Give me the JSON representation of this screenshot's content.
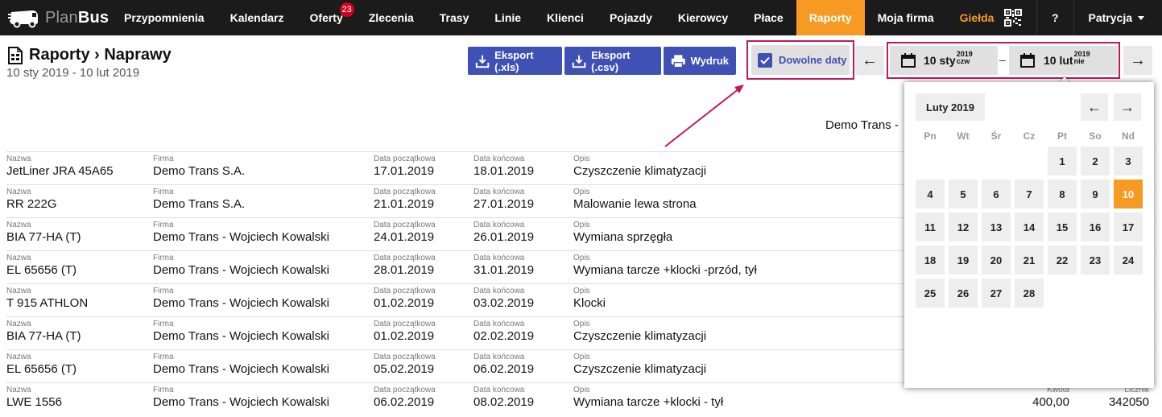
{
  "brand": {
    "part1": "Plan",
    "part2": "Bus"
  },
  "nav": {
    "items": [
      {
        "label": "Przypomnienia"
      },
      {
        "label": "Kalendarz"
      },
      {
        "label": "Oferty",
        "badge": "23"
      },
      {
        "label": "Zlecenia"
      },
      {
        "label": "Trasy"
      },
      {
        "label": "Linie"
      },
      {
        "label": "Klienci"
      },
      {
        "label": "Pojazdy"
      },
      {
        "label": "Kierowcy"
      },
      {
        "label": "Płace"
      },
      {
        "label": "Raporty",
        "active": true
      },
      {
        "label": "Moja firma"
      },
      {
        "label": "Giełda",
        "accent": true
      }
    ],
    "help": "?",
    "user": "Patrycja"
  },
  "header": {
    "title": "Raporty › Naprawy",
    "subtitle": "10 sty 2019 - 10 lut 2019"
  },
  "toolbar": {
    "export_xls": "Eksport (.xls)",
    "export_csv": "Eksport (.csv)",
    "print": "Wydruk",
    "custom_dates": "Dowolne daty",
    "date_from": {
      "main": "10 sty",
      "year": "2019",
      "dow": "czw"
    },
    "date_to": {
      "main": "10 lut",
      "year": "2019",
      "dow": "nie"
    },
    "date_sep": "–",
    "prev_arrow": "←",
    "next_arrow": "→"
  },
  "company_heading": "Demo Trans -",
  "table": {
    "labels": {
      "name": "Nazwa",
      "company": "Firma",
      "start": "Data początkowa",
      "end": "Data końcowa",
      "desc": "Opis",
      "amount": "Kwota",
      "counter": "Licznik"
    },
    "rows": [
      {
        "name": "JetLiner JRA 45A65",
        "company": "Demo Trans S.A.",
        "start": "17.01.2019",
        "end": "18.01.2019",
        "desc": "Czyszczenie klimatyzacji"
      },
      {
        "name": "RR 222G",
        "company": "Demo Trans S.A.",
        "start": "21.01.2019",
        "end": "27.01.2019",
        "desc": "Malowanie lewa strona"
      },
      {
        "name": "BIA 77-HA (T)",
        "company": "Demo Trans - Wojciech Kowalski",
        "start": "24.01.2019",
        "end": "26.01.2019",
        "desc": "Wymiana sprzęgła"
      },
      {
        "name": "EL 65656 (T)",
        "company": "Demo Trans - Wojciech Kowalski",
        "start": "28.01.2019",
        "end": "31.01.2019",
        "desc": "Wymiana tarcze +klocki -przód, tył"
      },
      {
        "name": "T 915 ATHLON",
        "company": "Demo Trans - Wojciech Kowalski",
        "start": "01.02.2019",
        "end": "03.02.2019",
        "desc": "Klocki"
      },
      {
        "name": "BIA 77-HA (T)",
        "company": "Demo Trans - Wojciech Kowalski",
        "start": "01.02.2019",
        "end": "02.02.2019",
        "desc": "Czyszczenie klimatyzacji"
      },
      {
        "name": "EL 65656 (T)",
        "company": "Demo Trans - Wojciech Kowalski",
        "start": "05.02.2019",
        "end": "06.02.2019",
        "desc": "Czyszczenie klimatyzacji"
      },
      {
        "name": "LWE 1556",
        "company": "Demo Trans - Wojciech Kowalski",
        "start": "06.02.2019",
        "end": "08.02.2019",
        "desc": "Wymiana tarcze +klocki - tył",
        "amount": "400,00",
        "counter": "342050"
      }
    ]
  },
  "calendar": {
    "month": "Luty 2019",
    "prev": "←",
    "next": "→",
    "weekdays": [
      "Pn",
      "Wt",
      "Śr",
      "Cz",
      "Pt",
      "So",
      "Nd"
    ],
    "weeks": [
      [
        "",
        "",
        "",
        "",
        "1",
        "2",
        "3"
      ],
      [
        "4",
        "5",
        "6",
        "7",
        "8",
        "9",
        "10"
      ],
      [
        "11",
        "12",
        "13",
        "14",
        "15",
        "16",
        "17"
      ],
      [
        "18",
        "19",
        "20",
        "21",
        "22",
        "23",
        "24"
      ],
      [
        "25",
        "26",
        "27",
        "28",
        "",
        "",
        ""
      ]
    ],
    "selected": "10"
  },
  "colors": {
    "nav_bg": "#1b1b1b",
    "accent": "#f79a24",
    "primary": "#3f51b5",
    "highlight": "#c2185b",
    "badge": "#d0021b"
  }
}
